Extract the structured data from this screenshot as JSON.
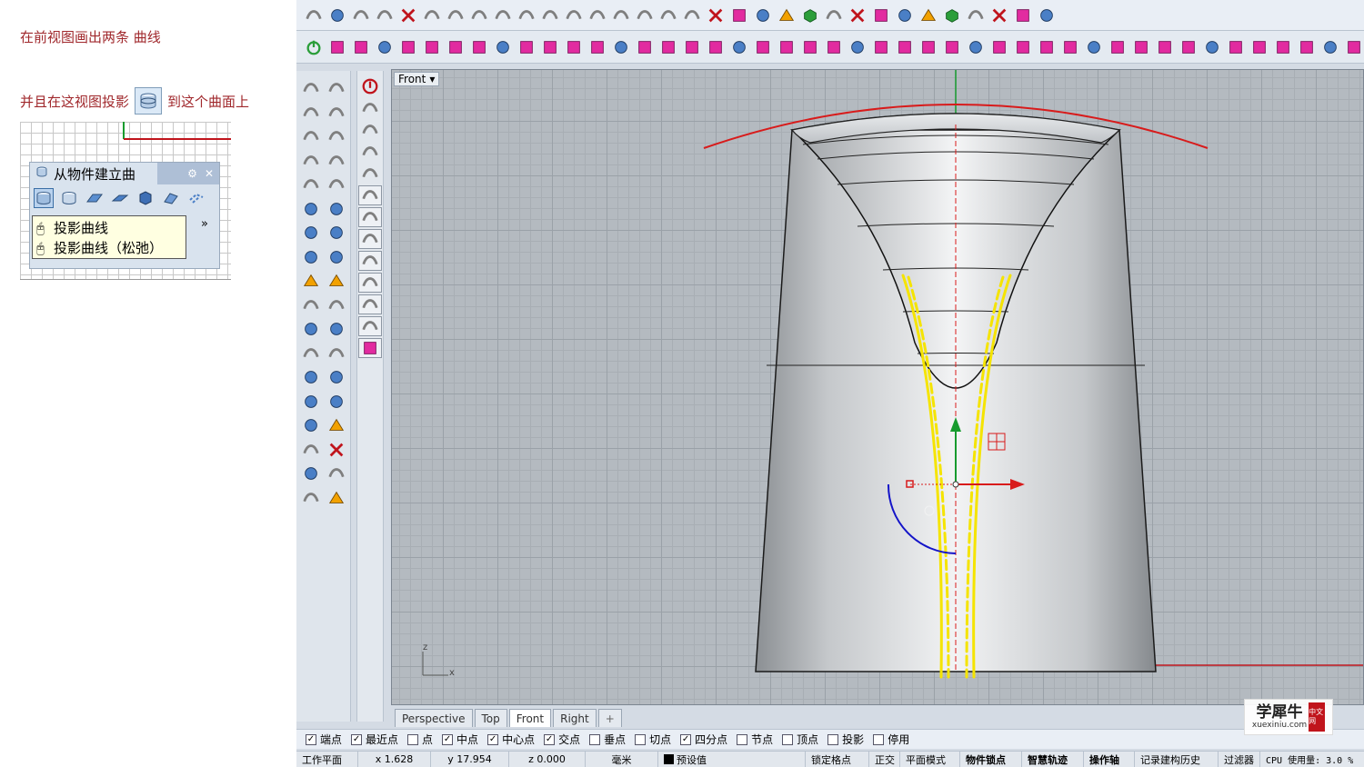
{
  "instruction": {
    "line1": "在前视图画出两条 曲线",
    "line2_before": "并且在这视图投影",
    "line2_after": "到这个曲面上",
    "flyout_title": "从物件建立曲",
    "tooltip": [
      "投影曲线",
      "投影曲线（松弛）"
    ],
    "more": "»"
  },
  "viewport": {
    "name": "Front",
    "dropdown_glyph": "▾",
    "axis_z": "z",
    "axis_x": "x"
  },
  "tabs": [
    "Perspective",
    "Top",
    "Front",
    "Right",
    "+"
  ],
  "active_tab": "Front",
  "osnap": [
    {
      "label": "端点",
      "checked": true
    },
    {
      "label": "最近点",
      "checked": true
    },
    {
      "label": "点",
      "checked": false
    },
    {
      "label": "中点",
      "checked": true
    },
    {
      "label": "中心点",
      "checked": true
    },
    {
      "label": "交点",
      "checked": true
    },
    {
      "label": "垂点",
      "checked": false
    },
    {
      "label": "切点",
      "checked": false
    },
    {
      "label": "四分点",
      "checked": true
    },
    {
      "label": "节点",
      "checked": false
    },
    {
      "label": "顶点",
      "checked": false
    },
    {
      "label": "投影",
      "checked": false
    },
    {
      "label": "停用",
      "checked": false
    }
  ],
  "status": {
    "cplane": "工作平面",
    "x": "x 1.628",
    "y": "y 17.954",
    "z": "z 0.000",
    "units": "毫米",
    "layer": "预设值",
    "grid_snap": "锁定格点",
    "ortho": "正交",
    "planar": "平面模式",
    "osnap": "物件锁点",
    "smarttrack": "智慧轨迹",
    "gumball": "操作轴",
    "history": "记录建构历史",
    "filter": "过滤器",
    "cpu": "CPU 使用量: 3.0 %"
  },
  "watermark": {
    "brand": "学犀牛",
    "url": "xuexiniu.com",
    "badge": "中文网"
  },
  "colors": {
    "accent_red": "#c0141c",
    "curve_yellow": "#f5e400",
    "gumball_green": "#179b2e",
    "gumball_blue": "#1414c8"
  },
  "toolbar_icons": [
    "new-icon",
    "open-icon",
    "save-icon",
    "print-icon",
    "import-icon",
    "cut-icon",
    "copy-icon",
    "paste-icon",
    "undo-icon",
    "pan-icon",
    "rotate-view-icon",
    "zoom-icon",
    "zoom-window-icon",
    "zoom-extents-icon",
    "zoom-selected-icon",
    "rotate-icon",
    "viewport-layout-icon",
    "car-icon",
    "mouse-icon",
    "properties-icon",
    "grid-icon",
    "light-icon",
    "lock-icon",
    "layer-icon",
    "color-icon",
    "shaded-icon",
    "render-icon",
    "sphere-icon",
    "material-icon",
    "settings-icon",
    "tools-icon",
    "help-icon"
  ]
}
